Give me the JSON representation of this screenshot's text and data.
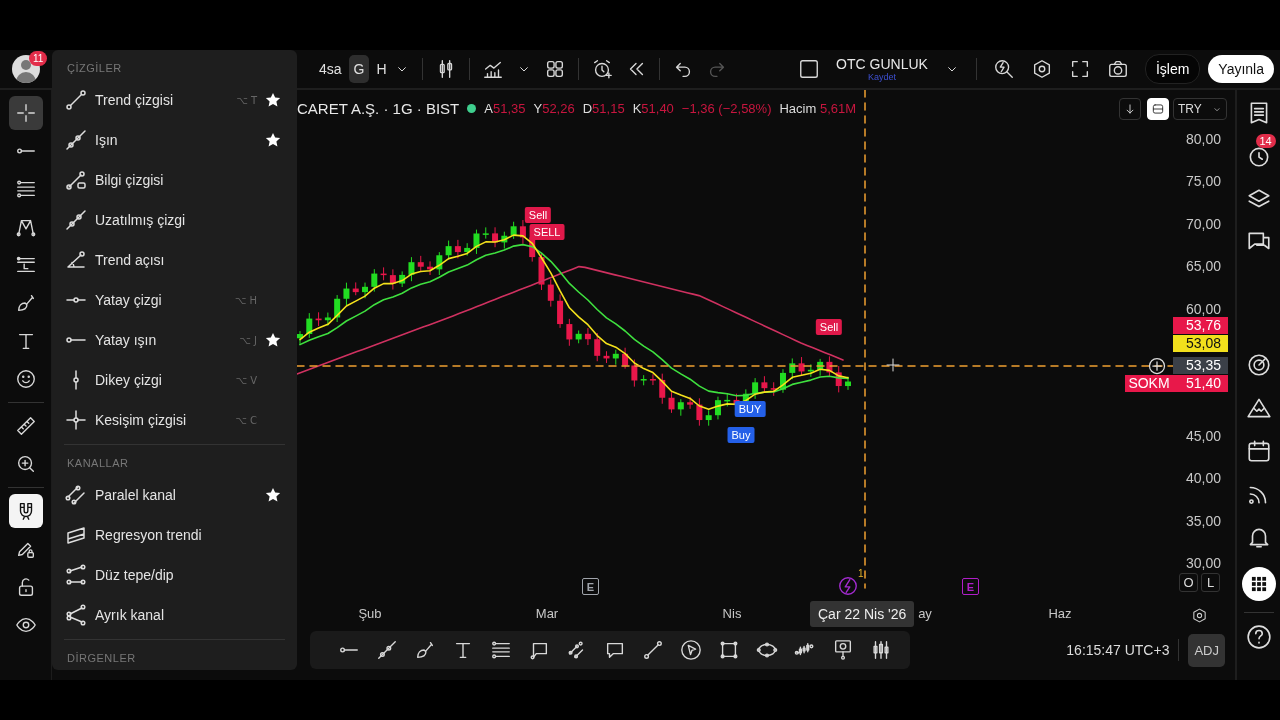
{
  "header": {
    "avatar_badge": "11",
    "intervals": [
      {
        "label": "4sa",
        "selected": false
      },
      {
        "label": "G",
        "selected": true
      },
      {
        "label": "H",
        "selected": false
      }
    ],
    "layout": {
      "name": "OTC GUNLUK",
      "status": "Kaydet"
    },
    "trade_button": "İşlem",
    "publish_button": "Yayınla"
  },
  "left_toolbar": {
    "tools": [
      {
        "selected": true
      },
      {
        "selected": false
      },
      {
        "selected": false
      },
      {
        "selected": false
      },
      {
        "selected": false
      },
      {
        "selected": false
      },
      {
        "selected": false
      },
      {
        "selected": false
      },
      {
        "selected": false
      },
      {
        "selected": false
      },
      {
        "selected": false
      },
      {
        "selected": false
      },
      {
        "selected": false
      }
    ],
    "magnet_mode": {
      "on": true
    }
  },
  "drawing_menu": {
    "sections": [
      {
        "title": "ÇİZGİLER",
        "items": [
          {
            "label": "Trend çizgisi",
            "shortcut": "⌥ T",
            "starred": true
          },
          {
            "label": "Işın",
            "starred": true
          },
          {
            "label": "Bilgi çizgisi",
            "starred": false
          },
          {
            "label": "Uzatılmış çizgi",
            "starred": false
          },
          {
            "label": "Trend açısı",
            "starred": false
          },
          {
            "label": "Yatay çizgi",
            "shortcut": "⌥ H",
            "starred": false
          },
          {
            "label": "Yatay ışın",
            "shortcut": "⌥ J",
            "starred": true
          },
          {
            "label": "Dikey çizgi",
            "shortcut": "⌥ V",
            "starred": false
          },
          {
            "label": "Kesişim çizgisi",
            "shortcut": "⌥ C",
            "starred": false
          }
        ]
      },
      {
        "title": "KANALLAR",
        "items": [
          {
            "label": "Paralel kanal",
            "starred": true
          },
          {
            "label": "Regresyon trendi",
            "starred": false
          },
          {
            "label": "Düz tepe/dip",
            "starred": false
          },
          {
            "label": "Ayrık kanal",
            "starred": false
          }
        ]
      },
      {
        "title": "DİRGENLER"
      }
    ]
  },
  "symbol_bar": {
    "title": "CARET A.Ş. · 1G · BIST",
    "market_open": true,
    "ohlc": [
      {
        "label": "A",
        "value": "51,35"
      },
      {
        "label": "Y",
        "value": "52,26"
      },
      {
        "label": "D",
        "value": "51,15"
      },
      {
        "label": "K",
        "value": "51,40"
      }
    ],
    "change": "−1,36 (−2,58%)",
    "volume_label": "Hacim",
    "volume": "5,61M"
  },
  "chart_controls": {
    "currency": "TRY",
    "auto_fit": {
      "on": true
    }
  },
  "signals": [
    {
      "text": "Sell",
      "kind": "sell"
    },
    {
      "text": "SELL",
      "kind": "sell"
    },
    {
      "text": "Sell",
      "kind": "sell"
    },
    {
      "text": "BUY",
      "kind": "buy"
    },
    {
      "text": "Buy",
      "kind": "buy"
    }
  ],
  "price_axis": {
    "labels_upper": [
      "80,00",
      "75,00",
      "70,00",
      "65,00",
      "60,00"
    ],
    "labels_lower": [
      "45,00",
      "40,00",
      "35,00",
      "30,00"
    ],
    "tags": [
      {
        "text": "53,76",
        "color": "#e8184a"
      },
      {
        "text": "53,08",
        "color": "#f2e01c"
      },
      {
        "text": "53,35",
        "color": "#3b4048"
      },
      {
        "text": "51,40",
        "color": "#e8184a",
        "symbol": "SOKM"
      }
    ]
  },
  "events": [
    {
      "kind": "earnings",
      "label": "E",
      "color": "#a0a4ab"
    },
    {
      "kind": "flash",
      "count": "1",
      "color": "#a32bd0"
    },
    {
      "kind": "earnings",
      "label": "E",
      "color": "#b01ec8"
    }
  ],
  "scale_buttons": [
    "O",
    "L"
  ],
  "time_axis": {
    "labels": [
      "Şub",
      "Mar",
      "Nis",
      "ay",
      "Haz"
    ]
  },
  "crosshair": {
    "date": "Çar 22 Nis '26"
  },
  "bottom_bar": {
    "time": "16:15:47 UTC+3",
    "adjust": {
      "label": "ADJ",
      "on": true
    }
  },
  "right_sidebar": {
    "alerts_badge": "14"
  }
}
